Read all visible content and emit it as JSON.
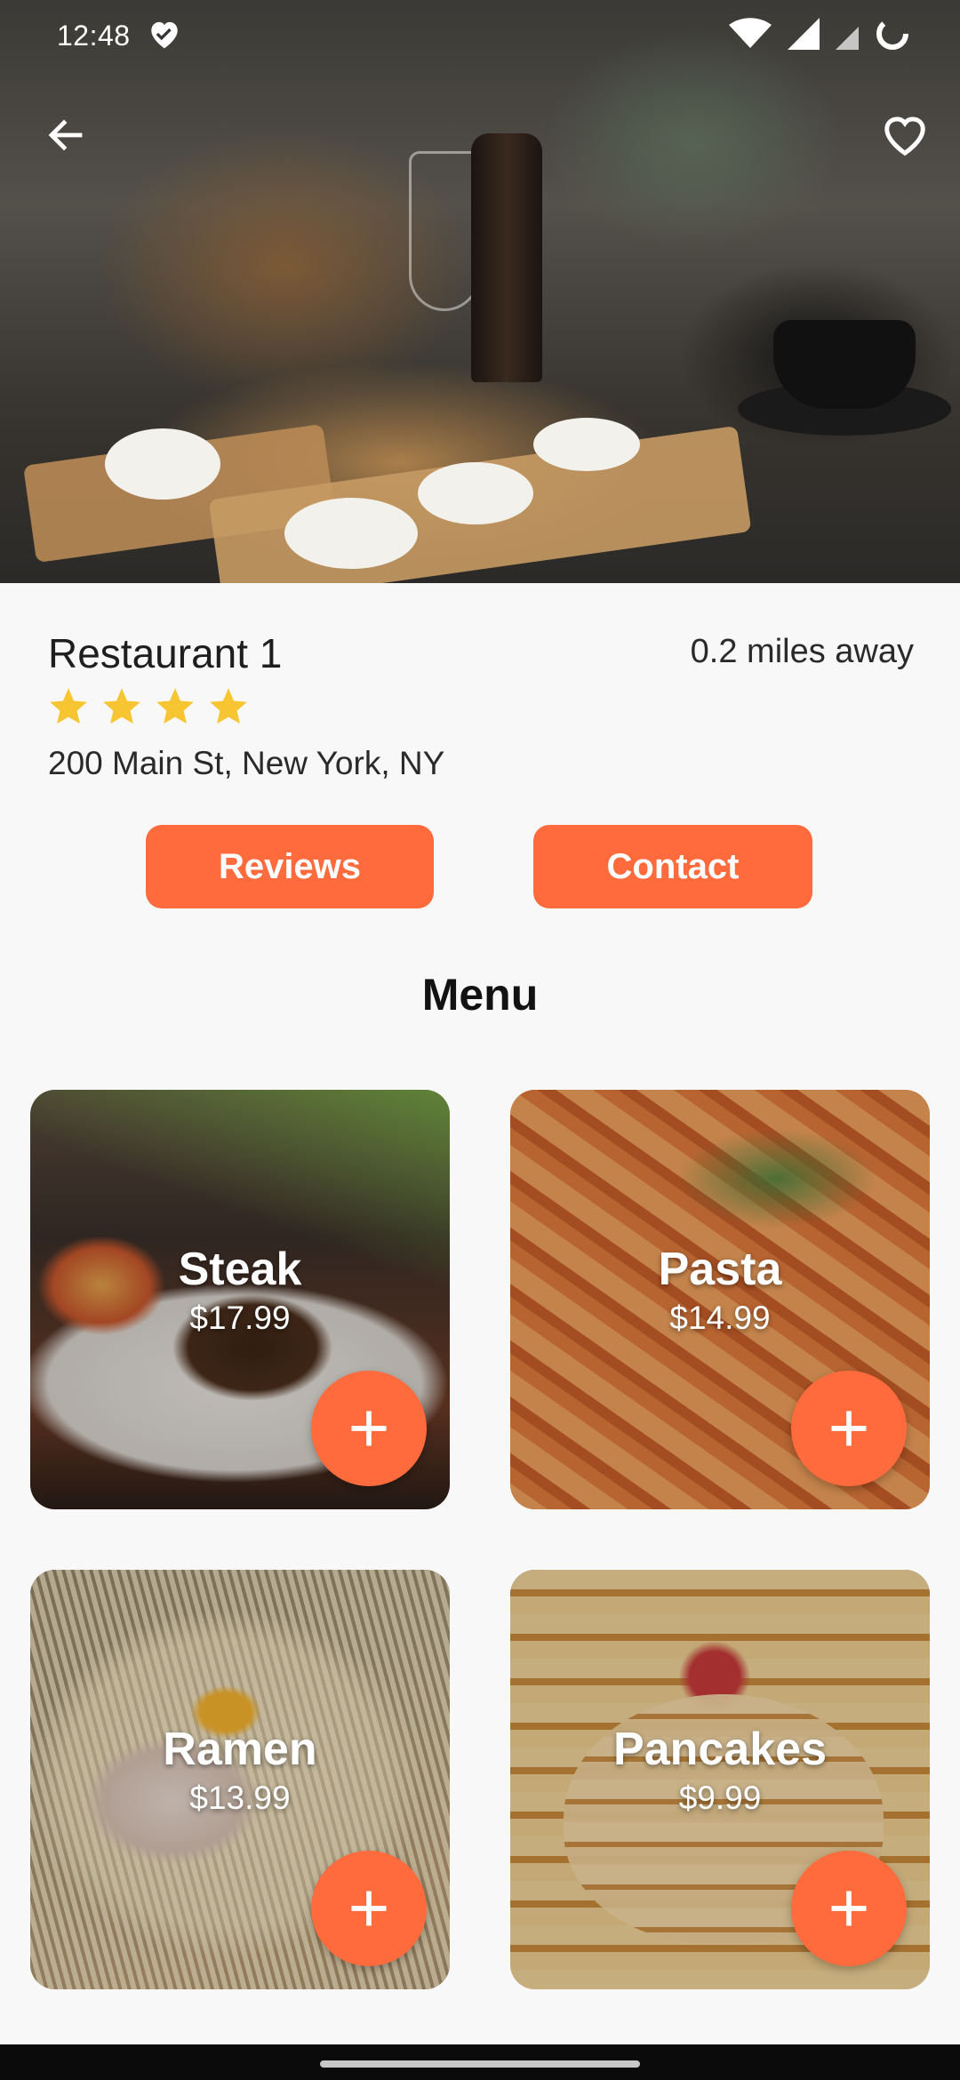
{
  "status_bar": {
    "time": "12:48"
  },
  "restaurant": {
    "name": "Restaurant 1",
    "distance": "0.2 miles away",
    "rating_stars": 4,
    "address": "200 Main St, New York, NY"
  },
  "actions": {
    "reviews_label": "Reviews",
    "contact_label": "Contact"
  },
  "menu": {
    "title": "Menu",
    "items": [
      {
        "name": "Steak",
        "price": "$17.99"
      },
      {
        "name": "Pasta",
        "price": "$14.99"
      },
      {
        "name": "Ramen",
        "price": "$13.99"
      },
      {
        "name": "Pancakes",
        "price": "$9.99"
      }
    ]
  },
  "colors": {
    "accent": "#ff6b3d",
    "star": "#f7c531",
    "background": "#f8f8f8"
  },
  "icons": {
    "back": "arrow-left-icon",
    "favorite": "heart-outline-icon",
    "add": "plus-icon",
    "star": "star-icon"
  }
}
